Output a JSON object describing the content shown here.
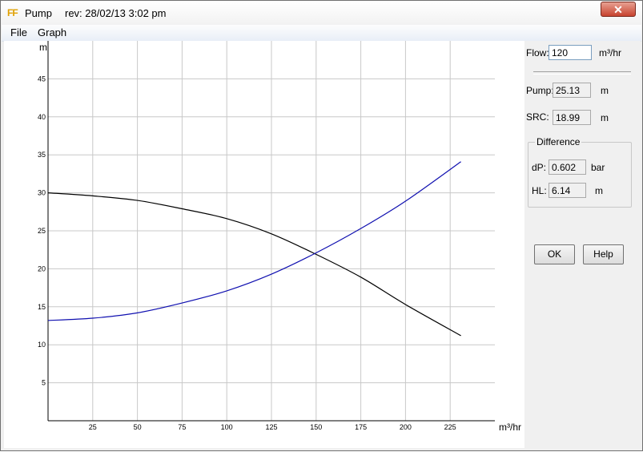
{
  "window": {
    "app_name": "Pump",
    "revision": "rev: 28/02/13  3:02 pm",
    "close_glyph": "✕",
    "icon_label": "FF"
  },
  "menu": [
    "File",
    "Graph"
  ],
  "panel": {
    "flow_label": "Flow:",
    "flow_value": "120",
    "flow_unit": "m³/hr",
    "pump_label": "Pump:",
    "pump_value": "25.13",
    "pump_unit": "m",
    "src_label": "SRC:",
    "src_value": "18.99",
    "src_unit": "m",
    "difference_title": "Difference",
    "dp_label": "dP:",
    "dp_value": "0.602",
    "dp_unit": "bar",
    "hl_label": "HL:",
    "hl_value": "6.14",
    "hl_unit": "m",
    "ok_label": "OK",
    "help_label": "Help"
  },
  "chart_data": {
    "type": "line",
    "xlabel": "m³/hr",
    "ylabel": "m",
    "xlim": [
      0,
      250
    ],
    "ylim": [
      0,
      50
    ],
    "x_ticks": [
      25,
      50,
      75,
      100,
      125,
      150,
      175,
      200,
      225
    ],
    "y_ticks": [
      5,
      10,
      15,
      20,
      25,
      30,
      35,
      40,
      45
    ],
    "grid": true,
    "series": [
      {
        "color": "#000000",
        "x": [
          0,
          25,
          50,
          75,
          100,
          125,
          150,
          175,
          200,
          231
        ],
        "y": [
          30.0,
          29.6,
          29.0,
          27.9,
          26.6,
          24.6,
          21.9,
          18.9,
          15.3,
          11.2
        ]
      },
      {
        "color": "#1010b0",
        "x": [
          0,
          25,
          50,
          75,
          100,
          125,
          150,
          175,
          200,
          231
        ],
        "y": [
          13.2,
          13.5,
          14.2,
          15.5,
          17.1,
          19.3,
          22.1,
          25.3,
          28.9,
          34.1
        ]
      }
    ]
  }
}
